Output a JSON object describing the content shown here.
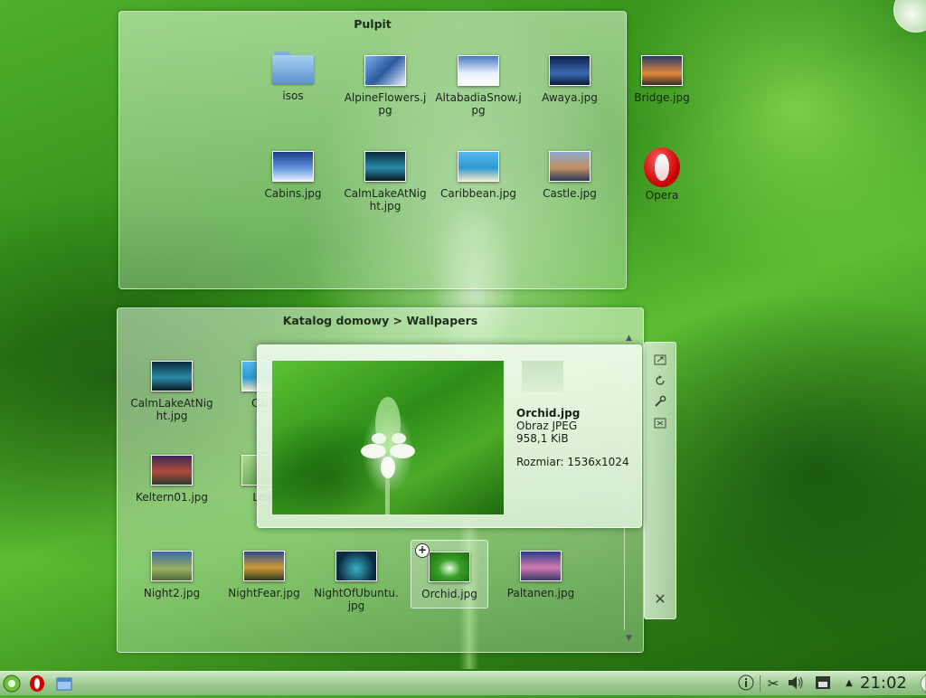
{
  "desktop_panel": {
    "title": "Pulpit",
    "items": [
      {
        "label": "isos",
        "kind": "folder"
      },
      {
        "label": "AlpineFlowers.jpg",
        "kind": "image",
        "color": "#3b6fb0"
      },
      {
        "label": "AltabadiaSnow.jpg",
        "kind": "image",
        "color": "#d9e6f3"
      },
      {
        "label": "Awaya.jpg",
        "kind": "image",
        "color": "#1e3a7a"
      },
      {
        "label": "Bridge.jpg",
        "kind": "image",
        "color": "#d07a3a"
      },
      {
        "label": "Cabins.jpg",
        "kind": "image",
        "color": "#2e5aa8"
      },
      {
        "label": "CalmLakeAtNight.jpg",
        "kind": "image",
        "color": "#14546a"
      },
      {
        "label": "Caribbean.jpg",
        "kind": "image",
        "color": "#2f9fd8"
      },
      {
        "label": "Castle.jpg",
        "kind": "image",
        "color": "#6f8fb8"
      },
      {
        "label": "Opera",
        "kind": "opera"
      }
    ]
  },
  "wallpapers_panel": {
    "title": "Katalog domowy > Wallpapers",
    "items": [
      {
        "label": "CalmLakeAtNight.jpg",
        "color": "#14546a"
      },
      {
        "label": "Cari",
        "color": "#2f9fd8"
      },
      {
        "label": "Keltern01.jpg",
        "color": "#4a3d5a"
      },
      {
        "label": "Lea",
        "color": "#6ca35a"
      },
      {
        "label": "Night2.jpg",
        "color": "#4a7a5a"
      },
      {
        "label": "NightFear.jpg",
        "color": "#6a4a20"
      },
      {
        "label": "NightOfUbuntu.jpg",
        "color": "#1c4f6e"
      },
      {
        "label": "Orchid.jpg",
        "color": "#3aa028"
      },
      {
        "label": "Paltanen.jpg",
        "color": "#5a5aa8"
      }
    ],
    "selected": "Orchid.jpg"
  },
  "preview": {
    "filename": "Orchid.jpg",
    "type": "Obraz JPEG",
    "size": "958,1 KiB",
    "dimensions": "Rozmiar: 1536x1024"
  },
  "side_toolbar": {
    "icons": [
      "maximize-icon",
      "rotate-icon",
      "wrench-icon",
      "resize-icon",
      "close-icon"
    ]
  },
  "taskbar": {
    "clock": "21:02",
    "tray_icons": [
      "info-icon",
      "scissors-icon",
      "volume-icon",
      "network-icon",
      "arrow-up-icon"
    ]
  },
  "colors": {
    "accent": "#4fb02a",
    "panel": "#cfe8c6"
  }
}
